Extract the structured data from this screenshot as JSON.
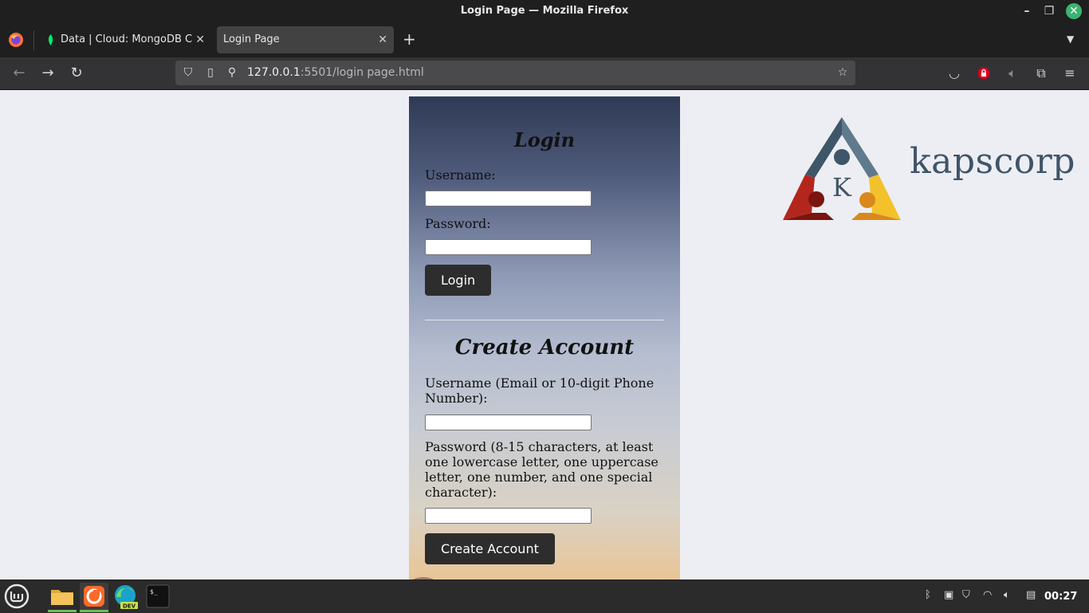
{
  "window": {
    "title": "Login Page — Mozilla Firefox"
  },
  "tabs": [
    {
      "label": "Data | Cloud: MongoDB Cloud",
      "active": false,
      "favicon": "mongodb-leaf-icon"
    },
    {
      "label": "Login Page",
      "active": true
    }
  ],
  "navbar": {
    "url_host": "127.0.0.1",
    "url_path": ":5501/login page.html"
  },
  "page": {
    "login": {
      "heading": "Login",
      "username_label": "Username:",
      "password_label": "Password:",
      "username_value": "",
      "password_value": "",
      "button_label": "Login"
    },
    "create_account": {
      "heading": "Create Account",
      "username_label": "Username (Email or 10-digit Phone Number):",
      "password_label": "Password (8-15 characters, at least one lowercase letter, one uppercase letter, one number, and one special character):",
      "username_value": "",
      "password_value": "",
      "button_label": "Create Account"
    },
    "logo": {
      "brand": "kapscorp",
      "letter": "K",
      "colors": {
        "top": "#4a6275",
        "left": "#b3261e",
        "right": "#f0b422"
      }
    }
  },
  "taskbar": {
    "apps": [
      "linux-mint-menu-icon",
      "files-icon",
      "firefox-icon",
      "edge-dev-icon",
      "terminal-icon"
    ],
    "edge_badge": "DEV",
    "terminal_glyph": "$_",
    "clock": "00:27"
  },
  "colors": {
    "accent_green": "#3cb371",
    "button_dark": "#2d2d2d"
  }
}
